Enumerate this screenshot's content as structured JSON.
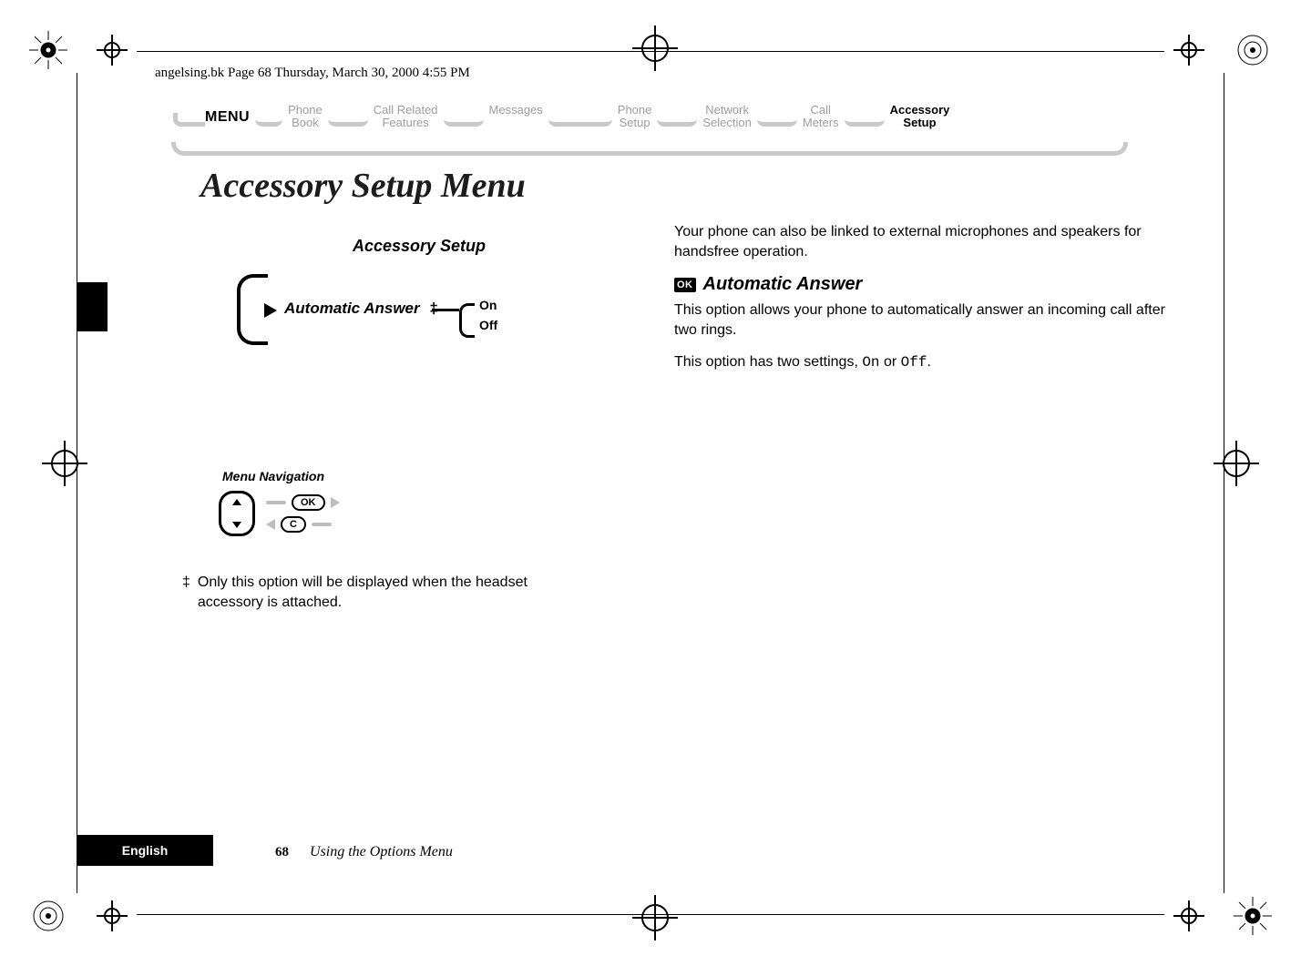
{
  "file_header": "angelsing.bk  Page 68  Thursday, March 30, 2000  4:55 PM",
  "menu_label": "MENU",
  "breadcrumb": [
    {
      "l1": "Phone",
      "l2": "Book",
      "active": false
    },
    {
      "l1": "Call Related",
      "l2": "Features",
      "active": false
    },
    {
      "l1": "Messages",
      "l2": "",
      "active": false
    },
    {
      "l1": "Phone",
      "l2": "Setup",
      "active": false
    },
    {
      "l1": "Network",
      "l2": "Selection",
      "active": false
    },
    {
      "l1": "Call",
      "l2": "Meters",
      "active": false
    },
    {
      "l1": "Accessory",
      "l2": "Setup",
      "active": true
    }
  ],
  "title": "Accessory Setup Menu",
  "diagram": {
    "heading": "Accessory Setup",
    "item": "Automatic Answer",
    "dagger": "‡",
    "opt_on": "On",
    "opt_off": "Off",
    "nav_title": "Menu Navigation",
    "ok": "OK",
    "c": "C"
  },
  "footnote": {
    "mark": "‡",
    "text": "Only this option will be displayed when the headset accessory is attached."
  },
  "right": {
    "intro": "Your phone can also be linked to external microphones and speakers for handsfree operation.",
    "ok_badge": "OK",
    "heading": "Automatic Answer",
    "p1": "This option allows your phone to automatically answer an incoming call after two rings.",
    "p2a": "This option has two settings, ",
    "p2_on": "On",
    "p2_mid": " or ",
    "p2_off": "Off",
    "p2b": "."
  },
  "footer": {
    "lang": "English",
    "page": "68",
    "section": "Using the Options Menu"
  }
}
